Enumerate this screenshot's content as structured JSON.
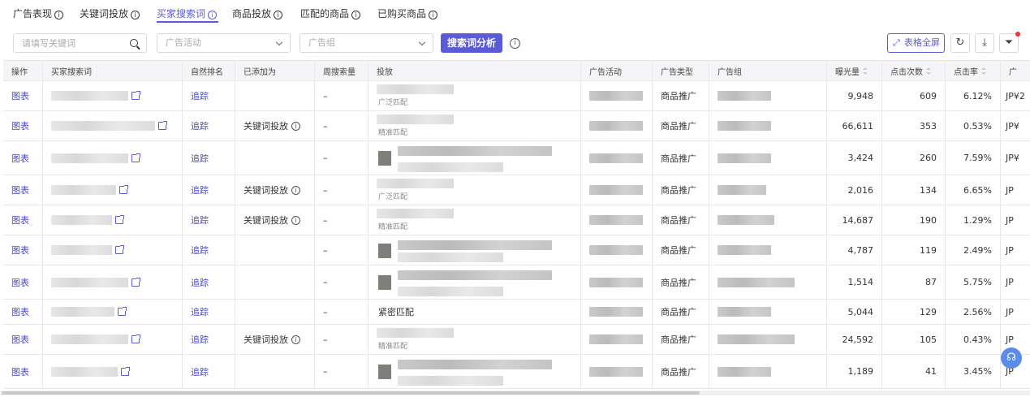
{
  "tabs": [
    {
      "label": "广告表现"
    },
    {
      "label": "关键词投放"
    },
    {
      "label": "买家搜索词"
    },
    {
      "label": "商品投放"
    },
    {
      "label": "匹配的商品"
    },
    {
      "label": "已购买商品"
    }
  ],
  "active_tab": "买家搜索词",
  "toolbar": {
    "search_placeholder": "请填写关键词",
    "campaign_placeholder": "广告活动",
    "adgroup_placeholder": "广告组",
    "analyze_button": "搜索词分析",
    "fullscreen_button": "表格全屏"
  },
  "columns": {
    "action": "操作",
    "search_term": "买家搜索词",
    "organic_rank": "自然排名",
    "added_as": "已添加为",
    "weekly_volume": "周搜索量",
    "targeting": "投放",
    "campaign": "广告活动",
    "ad_type": "广告类型",
    "ad_group": "广告组",
    "impressions": "曝光量",
    "clicks": "点击次数",
    "ctr": "点击率",
    "next": "广"
  },
  "rows": [
    {
      "action": "图表",
      "track": "追踪",
      "added": "",
      "weekly": "–",
      "match": "广泛匹配",
      "type": "商品推广",
      "impressions": "9,948",
      "clicks": "609",
      "ctr": "6.12%",
      "next": "JP¥2"
    },
    {
      "action": "图表",
      "track": "追踪",
      "added": "关键词投放",
      "weekly": "–",
      "match": "精准匹配",
      "type": "商品推广",
      "impressions": "66,611",
      "clicks": "353",
      "ctr": "0.53%",
      "next": "JP¥"
    },
    {
      "action": "图表",
      "track": "追踪",
      "added": "",
      "weekly": "–",
      "match": "",
      "type": "商品推广",
      "impressions": "3,424",
      "clicks": "260",
      "ctr": "7.59%",
      "next": "JP¥"
    },
    {
      "action": "图表",
      "track": "追踪",
      "added": "关键词投放",
      "weekly": "–",
      "match": "广泛匹配",
      "type": "商品推广",
      "impressions": "2,016",
      "clicks": "134",
      "ctr": "6.65%",
      "next": "JP"
    },
    {
      "action": "图表",
      "track": "追踪",
      "added": "关键词投放",
      "weekly": "–",
      "match": "精准匹配",
      "type": "商品推广",
      "impressions": "14,687",
      "clicks": "190",
      "ctr": "1.29%",
      "next": "JP"
    },
    {
      "action": "图表",
      "track": "追踪",
      "added": "",
      "weekly": "–",
      "match": "",
      "type": "商品推广",
      "impressions": "4,787",
      "clicks": "119",
      "ctr": "2.49%",
      "next": "JP"
    },
    {
      "action": "图表",
      "track": "追踪",
      "added": "",
      "weekly": "–",
      "match": "",
      "type": "商品推广",
      "impressions": "1,514",
      "clicks": "87",
      "ctr": "5.75%",
      "next": "JP"
    },
    {
      "action": "图表",
      "track": "追踪",
      "added": "",
      "weekly": "–",
      "match": "紧密匹配",
      "type": "商品推广",
      "impressions": "5,044",
      "clicks": "129",
      "ctr": "2.56%",
      "next": "JP"
    },
    {
      "action": "图表",
      "track": "追踪",
      "added": "关键词投放",
      "weekly": "–",
      "match": "精准匹配",
      "type": "商品推广",
      "impressions": "24,592",
      "clicks": "105",
      "ctr": "0.43%",
      "next": "JP"
    },
    {
      "action": "图表",
      "track": "追踪",
      "added": "",
      "weekly": "–",
      "match": "",
      "type": "商品推广",
      "impressions": "1,189",
      "clicks": "41",
      "ctr": "3.45%",
      "next": "JP"
    }
  ],
  "colors": {
    "accent": "#5b5bd6",
    "alert_dot": "#e33333"
  }
}
